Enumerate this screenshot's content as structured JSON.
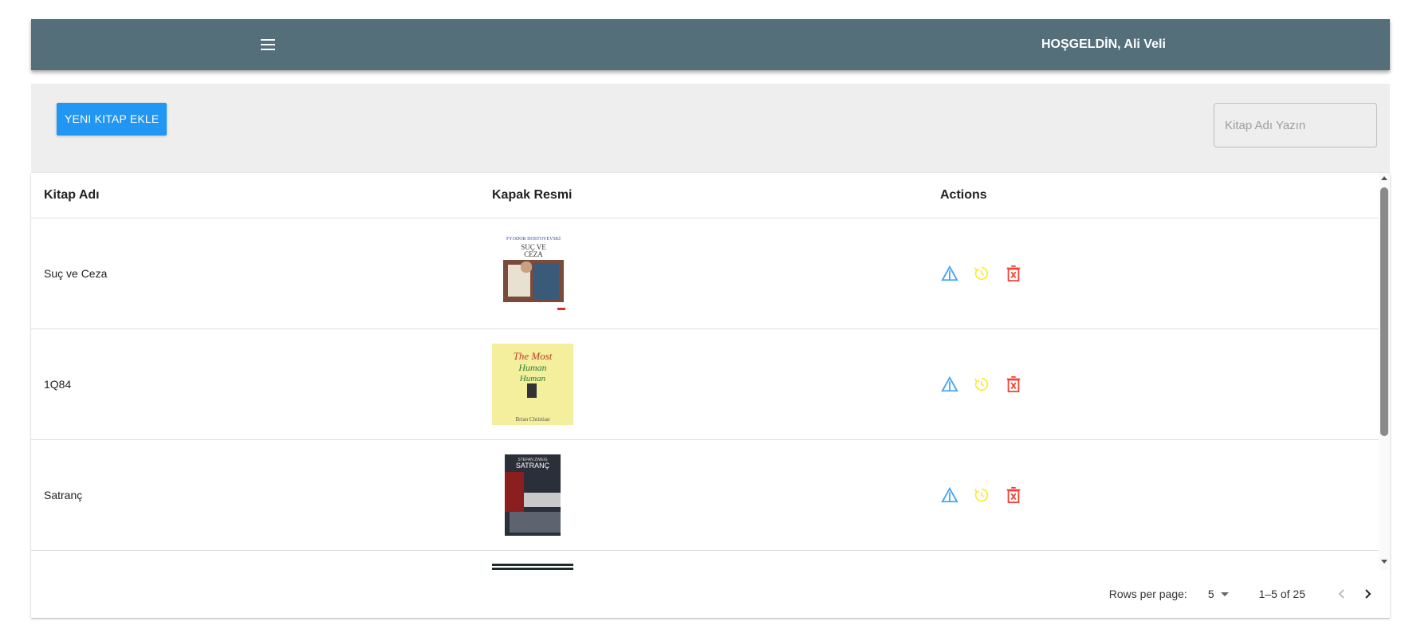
{
  "header": {
    "menu_icon": "menu-icon",
    "welcome_text": "HOŞGELDİN, Ali Veli"
  },
  "toolbar": {
    "add_book_label": "YENI KITAP EKLE",
    "search_placeholder": "Kitap Adı Yazın"
  },
  "table": {
    "columns": [
      "Kitap Adı",
      "Kapak Resmi",
      "Actions"
    ],
    "rows": [
      {
        "title": "Suç ve Ceza",
        "cover": {
          "author": "FYODOR DOSTOYEVSKİ",
          "line1": "SUÇ VE",
          "line2": "CEZA"
        }
      },
      {
        "title": "1Q84",
        "cover": {
          "line1": "The Most",
          "line2": "Human",
          "line3": "Human",
          "author": "Brian Christian"
        }
      },
      {
        "title": "Satranç",
        "cover": {
          "author": "STEFAN ZWEIG",
          "line1": "SATRANÇ"
        }
      },
      {
        "title": "",
        "cover": {}
      }
    ],
    "action_icons": [
      "warning-icon",
      "history-icon",
      "delete-icon"
    ],
    "colors": {
      "warning": "#42a5f5",
      "history": "#ffeb3b",
      "delete": "#f44336"
    }
  },
  "pagination": {
    "rows_per_page_label": "Rows per page:",
    "rows_per_page_value": "5",
    "range_text": "1–5 of 25"
  },
  "colors": {
    "appbar": "#546e7a",
    "primary": "#2196f3",
    "toolbar_bg": "#eeeeee"
  }
}
